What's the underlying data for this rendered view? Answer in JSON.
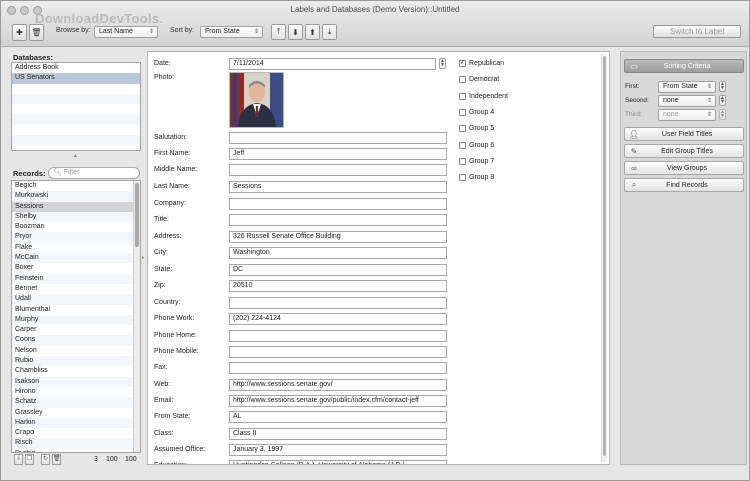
{
  "window": {
    "title": "Labels and Databases (Demo Version)::Untitled",
    "watermark": "DownloadDevTools."
  },
  "toolbar": {
    "browse_by_label": "Browse by:",
    "browse_by_value": "Last Name",
    "sort_by_label": "Sort by:",
    "sort_by_value": "From State",
    "switch_label": "Switch to Label"
  },
  "databases": {
    "label": "Databases:",
    "items": [
      "Address Book",
      "US Senators"
    ],
    "selected": "US Senators"
  },
  "records": {
    "label": "Records:",
    "filter_placeholder": "Filter",
    "items": [
      "Begich",
      "Murkowski",
      "Sessions",
      "Shelby",
      "Boozman",
      "Pryor",
      "Flake",
      "McCain",
      "Boxer",
      "Feinstein",
      "Bennet",
      "Udall",
      "Blumenthal",
      "Murphy",
      "Carper",
      "Coons",
      "Nelson",
      "Rubio",
      "Chambliss",
      "Isakson",
      "Hirono",
      "Schatz",
      "Grassley",
      "Harkin",
      "Crapo",
      "Risch",
      "Durbin"
    ],
    "selected": "Sessions",
    "count_current": "3",
    "count_shown": "100",
    "count_total": "100"
  },
  "form": {
    "fields": [
      {
        "label": "Date:",
        "value": "7/11/2014"
      },
      {
        "label": "Photo:",
        "value": ""
      },
      {
        "label": "Salutation:",
        "value": ""
      },
      {
        "label": "First Name:",
        "value": "Jeff"
      },
      {
        "label": "Middle Name:",
        "value": ""
      },
      {
        "label": "Last Name:",
        "value": "Sessions"
      },
      {
        "label": "Company:",
        "value": ""
      },
      {
        "label": "Title:",
        "value": ""
      },
      {
        "label": "Address:",
        "value": "326 Russell Senate Office Building"
      },
      {
        "label": "City:",
        "value": "Washington"
      },
      {
        "label": "State:",
        "value": "DC"
      },
      {
        "label": "Zip:",
        "value": "20510"
      },
      {
        "label": "Country:",
        "value": ""
      },
      {
        "label": "Phone Work:",
        "value": "(202) 224-4124"
      },
      {
        "label": "Phone Home:",
        "value": ""
      },
      {
        "label": "Phone Mobile:",
        "value": ""
      },
      {
        "label": "Fax:",
        "value": ""
      },
      {
        "label": "Web:",
        "value": "http://www.sessions.senate.gov/"
      },
      {
        "label": "Email:",
        "value": "http://www.sessions.senate.gov/public/index.cfm/contact-jeff"
      },
      {
        "label": "From State:",
        "value": "AL"
      },
      {
        "label": "Class:",
        "value": "Class II"
      },
      {
        "label": "Assumed Office:",
        "value": "January 3, 1997"
      },
      {
        "label": "Education:",
        "value": "Huntingdon College (B.A.), University of Alabama (J.D.)"
      }
    ],
    "groups": [
      {
        "label": "Republican",
        "checked": true
      },
      {
        "label": "Democrat",
        "checked": false
      },
      {
        "label": "Independent",
        "checked": false
      },
      {
        "label": "Group 4",
        "checked": false
      },
      {
        "label": "Group 5",
        "checked": false
      },
      {
        "label": "Group 6",
        "checked": false
      },
      {
        "label": "Group 7",
        "checked": false
      },
      {
        "label": "Group 8",
        "checked": false
      }
    ]
  },
  "sorting": {
    "header": "Sorting Criteria",
    "first_label": "First:",
    "first_value": "From State",
    "second_label": "Second:",
    "second_value": "none",
    "third_label": "Third:",
    "third_value": "none"
  },
  "actions": {
    "user_field_titles": "User Field Titles",
    "edit_group_titles": "Edit Group Titles",
    "view_groups": "View Groups",
    "find_records": "Find Records"
  }
}
